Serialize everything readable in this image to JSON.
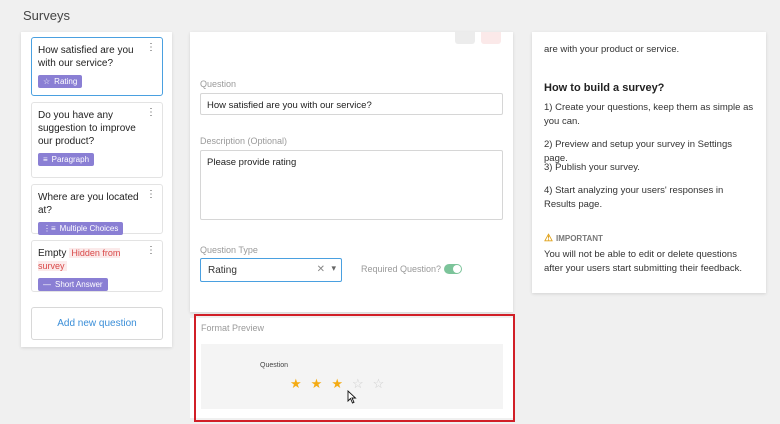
{
  "header": {
    "title": "Surveys"
  },
  "questions": [
    {
      "text": "How satisfied are you with our service?",
      "type": "Rating",
      "type_icon": "star-outline-icon"
    },
    {
      "text": "Do you have any suggestion to improve our product?",
      "type": "Paragraph",
      "type_icon": "paragraph-lines-icon"
    },
    {
      "text": "Where are you located at?",
      "type": "Multiple Choices",
      "type_icon": "list-bullets-icon"
    },
    {
      "text": "Empty",
      "hidden_label": "Hidden from survey",
      "type": "Short Answer",
      "type_icon": "dash-icon"
    }
  ],
  "add_question_label": "Add new question",
  "editor": {
    "question_label": "Question",
    "question_value": "How satisfied are you with our service?",
    "description_label": "Description (Optional)",
    "description_value": "Please provide rating",
    "type_label": "Question Type",
    "type_value": "Rating",
    "required_label": "Required Question?",
    "required_on": true
  },
  "preview": {
    "label": "Format Preview",
    "question_text": "Question",
    "rating_filled": 3,
    "rating_max": 5
  },
  "help": {
    "intro_fragment": "are with your product or service.",
    "heading": "How to build a survey?",
    "steps": [
      "1) Create your questions, keep them as simple as you can.",
      "2) Preview and setup your survey in Settings page.",
      "3) Publish your survey.",
      "4) Start analyzing your users' responses in Results page."
    ],
    "important_label": "IMPORTANT",
    "important_text": "You will not be able to edit or delete questions after your users start submitting their feedback."
  },
  "colors": {
    "accent": "#4aa0e0",
    "tag": "#8a7fd4",
    "star": "#f4ab13",
    "highlight": "#d11f27",
    "toggle": "#7cc49a"
  }
}
